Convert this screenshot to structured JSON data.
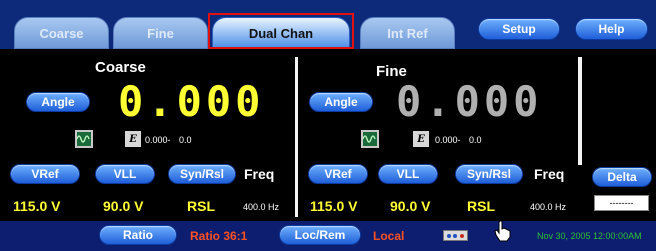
{
  "tabs": [
    {
      "label": "Coarse"
    },
    {
      "label": "Fine"
    },
    {
      "label": "Dual Chan"
    },
    {
      "label": "Int Ref"
    }
  ],
  "header_buttons": {
    "setup": "Setup",
    "help": "Help"
  },
  "coarse_panel": {
    "title": "Coarse",
    "angle_button": "Angle",
    "readout": "0.000",
    "small_value_a": "0.000-",
    "small_value_b": "0.0",
    "e_button": "E"
  },
  "fine_panel": {
    "title": "Fine",
    "angle_button": "Angle",
    "readout": "0.000",
    "small_value_a": "0.000-",
    "small_value_b": "0.0",
    "e_button": "E"
  },
  "coarse_controls": {
    "vref_button": "VRef",
    "vll_button": "VLL",
    "synrsl_button": "Syn/Rsl",
    "freq_label": "Freq",
    "vref_value": "115.0 V",
    "vll_value": "90.0 V",
    "mode_value": "RSL",
    "freq_value": "400.0 Hz"
  },
  "fine_controls": {
    "vref_button": "VRef",
    "vll_button": "VLL",
    "synrsl_button": "Syn/Rsl",
    "freq_label": "Freq",
    "vref_value": "115.0 V",
    "vll_value": "90.0 V",
    "mode_value": "RSL",
    "freq_value": "400.0 Hz"
  },
  "delta": {
    "button": "Delta",
    "value": "--------"
  },
  "footer": {
    "ratio_button": "Ratio",
    "ratio_value": "Ratio 36:1",
    "locrem_button": "Loc/Rem",
    "locrem_value": "Local",
    "timestamp": "Nov 30, 2005 12:00:00AM"
  },
  "colors": {
    "readout_active": "#ffff33",
    "readout_inactive": "#b0b0b0",
    "footer_accent": "#ff5020",
    "timestamp": "#2ec02e"
  },
  "icons": {
    "wave": "waveform-icon",
    "connector": "connector-icon",
    "cursor": "hand-cursor-icon"
  }
}
